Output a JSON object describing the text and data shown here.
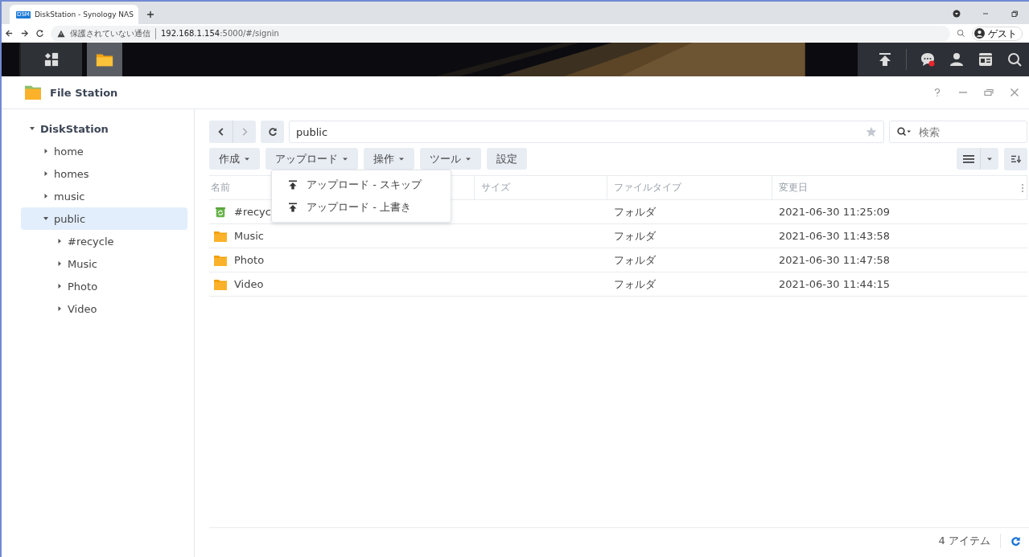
{
  "browser": {
    "tab_title": "DiskStation - Synology NAS",
    "favicon": "DSM",
    "security": "保護されていない通信",
    "url_host": "192.168.1.154",
    "url_rest": ":5000/#/signin",
    "profile": "ゲスト"
  },
  "window": {
    "title": "File Station"
  },
  "tree": [
    {
      "label": "DiskStation",
      "expanded": true,
      "selected": false,
      "children": [
        {
          "label": "home",
          "expanded": false,
          "selected": false
        },
        {
          "label": "homes",
          "expanded": false,
          "selected": false
        },
        {
          "label": "music",
          "expanded": false,
          "selected": false
        },
        {
          "label": "public",
          "expanded": true,
          "selected": true,
          "children": [
            {
              "label": "#recycle",
              "expanded": false,
              "selected": false
            },
            {
              "label": "Music",
              "expanded": false,
              "selected": false
            },
            {
              "label": "Photo",
              "expanded": false,
              "selected": false
            },
            {
              "label": "Video",
              "expanded": false,
              "selected": false
            }
          ]
        }
      ]
    }
  ],
  "path": {
    "value": "public"
  },
  "search": {
    "placeholder": "検索"
  },
  "toolbar": [
    {
      "label": "作成",
      "dropdown": true
    },
    {
      "label": "アップロード",
      "dropdown": true
    },
    {
      "label": "操作",
      "dropdown": true
    },
    {
      "label": "ツール",
      "dropdown": true
    },
    {
      "label": "設定",
      "dropdown": false
    }
  ],
  "menu": [
    {
      "label": "アップロード - スキップ"
    },
    {
      "label": "アップロード - 上書き"
    }
  ],
  "table": {
    "columns": [
      "名前",
      "サイズ",
      "ファイルタイプ",
      "変更日"
    ],
    "rows": [
      {
        "name": "#recyc",
        "kind": "recycle",
        "type": "フォルダ",
        "modified": "2021-06-30 11:25:09"
      },
      {
        "name": "Music",
        "kind": "folder",
        "type": "フォルダ",
        "modified": "2021-06-30 11:43:58"
      },
      {
        "name": "Photo",
        "kind": "folder",
        "type": "フォルダ",
        "modified": "2021-06-30 11:47:58"
      },
      {
        "name": "Video",
        "kind": "folder",
        "type": "フォルダ",
        "modified": "2021-06-30 11:44:15"
      }
    ]
  },
  "status_bar": {
    "count": "4 アイテム"
  }
}
